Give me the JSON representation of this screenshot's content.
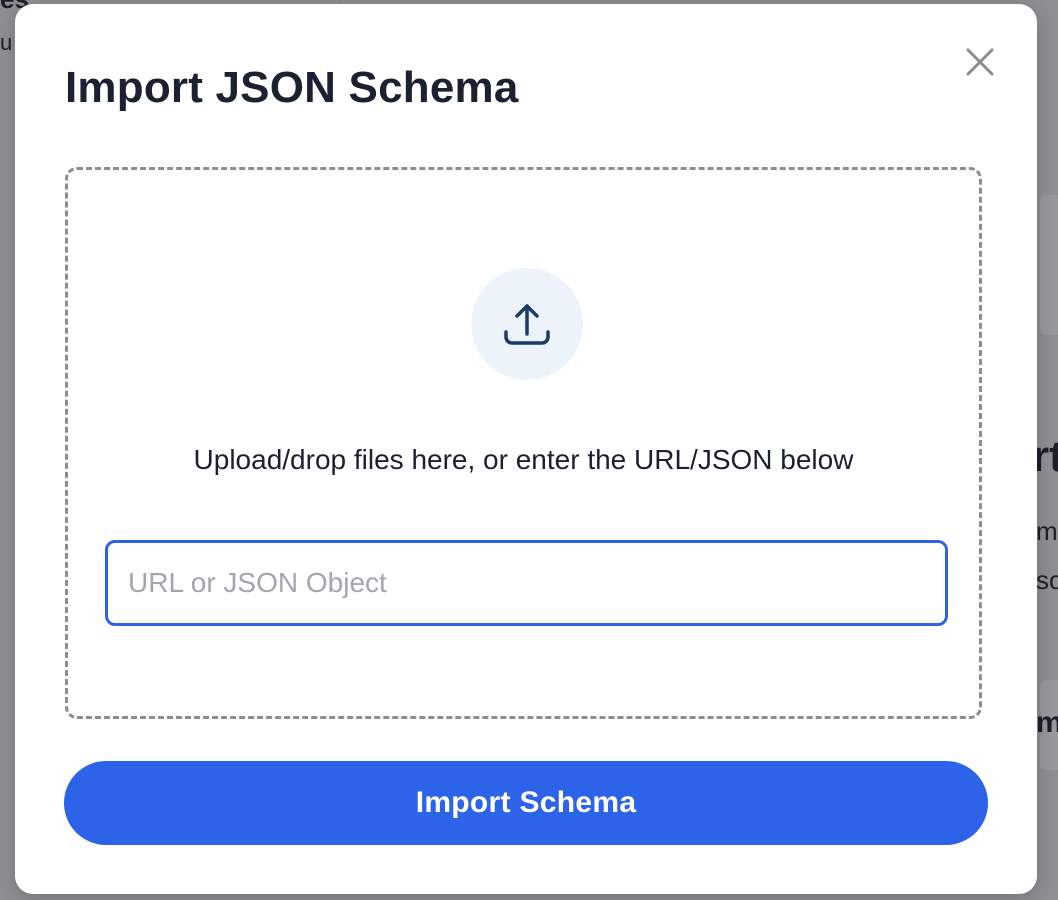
{
  "background": {
    "fragments": [
      "es",
      "u",
      "rt",
      "m",
      "so",
      "m"
    ]
  },
  "modal": {
    "title": "Import JSON Schema",
    "close_icon": "close-icon",
    "dropzone": {
      "icon": "upload-icon",
      "instruction": "Upload/drop files here, or enter the URL/JSON below",
      "input": {
        "value": "",
        "placeholder": "URL or JSON Object"
      }
    },
    "import_button_label": "Import Schema"
  },
  "colors": {
    "accent": "#2c63e8",
    "input_border": "#2f63e4",
    "title_text": "#1b2130",
    "upload_circle_bg": "#edf3fa",
    "upload_icon": "#1e3a66",
    "dropzone_border": "#8e8e8e",
    "overlay": "#8d8f93"
  }
}
